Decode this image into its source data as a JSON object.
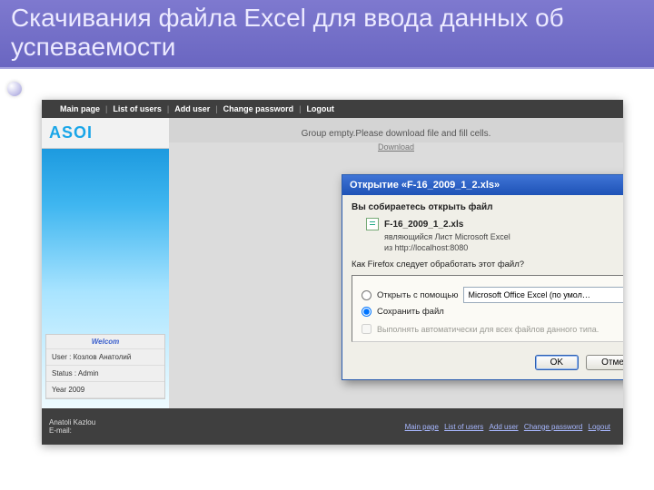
{
  "slide": {
    "title": "Скачивания файла Excel для ввода данных об успеваемости"
  },
  "nav": {
    "items": [
      "Main page",
      "List of users",
      "Add user",
      "Change password",
      "Logout"
    ]
  },
  "logo": "ASOI",
  "sidebar": {
    "welcome": "Welcom",
    "user_label": "User :",
    "user_value": "Козлов Анатолий",
    "status_label": "Status :",
    "status_value": "Admin",
    "year": "Year 2009"
  },
  "content": {
    "message": "Group empty.Please download file and fill cells.",
    "download": "Download"
  },
  "footer": {
    "author": "Anatoli Kazlou",
    "email_label": "E-mail:",
    "links": [
      "Main page",
      "List of users",
      "Add user",
      "Change password",
      "Logout"
    ]
  },
  "dialog": {
    "title": "Открытие «F-16_2009_1_2.xls»",
    "intro": "Вы собираетесь открыть файл",
    "filename": "F-16_2009_1_2.xls",
    "type_line": "являющийся Лист Microsoft Excel",
    "from_line": "из http://localhost:8080",
    "question": "Как Firefox следует обработать этот файл?",
    "open_with": "Открыть с помощью",
    "app_selected": "Microsoft Office Excel (по умол…",
    "save": "Сохранить файл",
    "remember": "Выполнять автоматически для всех файлов данного типа.",
    "ok": "OK",
    "cancel": "Отмена"
  }
}
